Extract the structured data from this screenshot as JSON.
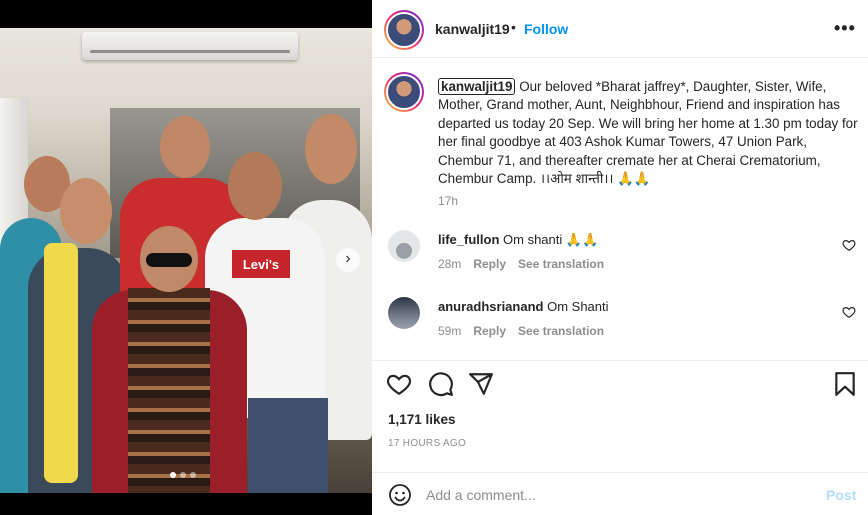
{
  "media": {
    "shirt_logo": "Levi's",
    "carousel_dots": 3,
    "active_dot": 0
  },
  "header": {
    "username": "kanwaljit19",
    "separator": "•",
    "follow_label": "Follow",
    "more_label": "•••"
  },
  "caption": {
    "username": "kanwaljit19",
    "text": "Our beloved *Bharat jaffrey*, Daughter, Sister, Wife, Mother, Grand mother, Aunt, Neighbhour, Friend and inspiration has departed us today 20 Sep. We will bring her home at 1.30 pm today for her final goodbye at 403 Ashok Kumar Towers, 47 Union Park, Chembur 71, and thereafter cremate her at Cherai Crematorium, Chembur Camp. ।।ओम शान्ती।। 🙏🙏",
    "time": "17h"
  },
  "comments": [
    {
      "username": "life_fullon",
      "text": "Om shanti 🙏🙏",
      "time": "28m",
      "reply": "Reply",
      "translate": "See translation"
    },
    {
      "username": "anuradhsrianand",
      "text": "Om Shanti",
      "time": "59m",
      "reply": "Reply",
      "translate": "See translation"
    }
  ],
  "actions": {
    "icons": [
      "heart-icon",
      "comment-icon",
      "share-icon",
      "bookmark-icon"
    ]
  },
  "likes": "1,171 likes",
  "posted_ago": "17 HOURS AGO",
  "add_comment": {
    "placeholder": "Add a comment...",
    "post_label": "Post"
  },
  "colors": {
    "accent": "#0095f6",
    "post_disabled": "#b2dffc",
    "muted": "#8e8e8e",
    "text": "#262626"
  }
}
